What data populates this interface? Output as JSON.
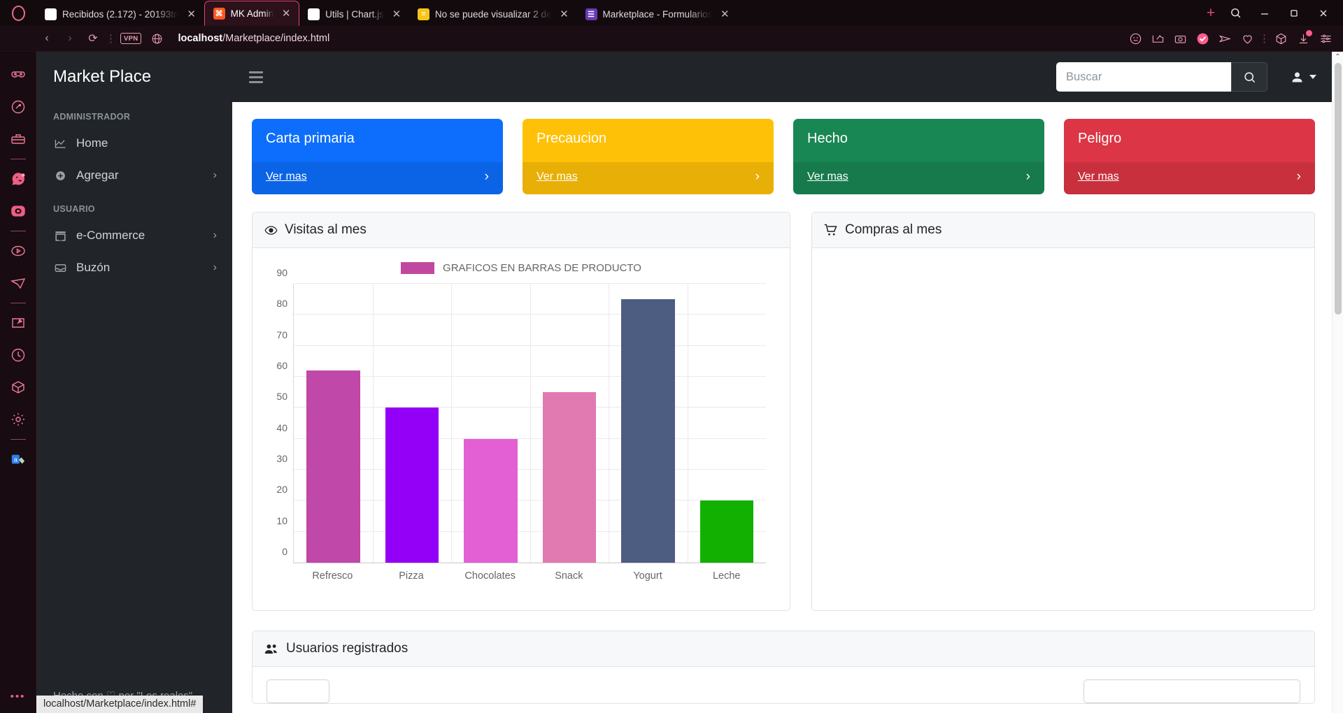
{
  "browser": {
    "tabs": [
      {
        "title": "Recibidos (2.172) - 20193tn",
        "favicon": "gmail-icon",
        "active": false
      },
      {
        "title": "MK Admin",
        "favicon": "mk-admin-icon",
        "active": true
      },
      {
        "title": "Utils | Chart.js",
        "favicon": "chartjs-icon",
        "active": false
      },
      {
        "title": "No se puede visualizar 2 de",
        "favicon": "sheets-icon",
        "active": false
      },
      {
        "title": "Marketplace - Formularios",
        "favicon": "forms-icon",
        "active": false
      }
    ],
    "new_tab_label": "+",
    "window_controls": {
      "search": "⌕",
      "minimize": "—",
      "maximize": "❐",
      "close": "✕"
    },
    "address": {
      "back": "‹",
      "forward": "›",
      "reload": "⟳",
      "vpn_badge": "VPN",
      "url_bold": "localhost",
      "url_rest": "/Marketplace/index.html"
    },
    "toolbar_icons": [
      "emoji-icon",
      "snapshot-icon",
      "camera-icon",
      "shield-check-icon",
      "send-icon",
      "heart-icon",
      "cube-icon",
      "download-icon",
      "settings-sliders-icon"
    ],
    "rail_icons": [
      "vpn-mask-icon",
      "search-tabs-icon",
      "workspace-icon",
      "whatsapp-icon",
      "instagram-icon",
      "player-icon",
      "telegram-icon",
      "pinboard-icon",
      "history-icon",
      "cube-icon",
      "settings-gear-icon",
      "extension-icon"
    ],
    "rail_more": "•••",
    "status_tooltip": "localhost/Marketplace/index.html#"
  },
  "app": {
    "brand": "Market Place",
    "sidebar": {
      "sections": [
        {
          "label": "ADMINISTRADOR",
          "items": [
            {
              "label": "Home",
              "icon": "chart-line-icon",
              "chevron": false
            },
            {
              "label": "Agregar",
              "icon": "plus-circle-icon",
              "chevron": true
            }
          ]
        },
        {
          "label": "USUARIO",
          "items": [
            {
              "label": "e-Commerce",
              "icon": "store-icon",
              "chevron": true
            },
            {
              "label": "Buzón",
              "icon": "inbox-icon",
              "chevron": true
            }
          ]
        }
      ],
      "footer": "Hecho con ♡ por \"Los reales\""
    },
    "topbar": {
      "menu_toggle": "hamburger-icon",
      "search_placeholder": "Buscar",
      "search_value": "",
      "search_button_icon": "search-icon",
      "user_icon": "user-icon"
    },
    "alert_cards": [
      {
        "title": "Carta primaria",
        "link": "Ver mas",
        "color": "#0d6efd",
        "arrow": "›"
      },
      {
        "title": "Precaucion",
        "link": "Ver mas",
        "color": "#ffc107",
        "arrow": "›"
      },
      {
        "title": "Hecho",
        "link": "Ver mas",
        "color": "#198754",
        "arrow": "›"
      },
      {
        "title": "Peligro",
        "link": "Ver mas",
        "color": "#dc3545",
        "arrow": "›"
      }
    ],
    "panels": {
      "visitas": {
        "title": "Visitas al mes",
        "icon": "eye-icon"
      },
      "compras": {
        "title": "Compras al mes",
        "icon": "cart-icon"
      },
      "usuarios": {
        "title": "Usuarios registrados",
        "icon": "users-icon"
      }
    },
    "scrollbar": {
      "up": "⌃",
      "down": "⌄"
    }
  },
  "chart_data": {
    "type": "bar",
    "title": "GRAFICOS EN BARRAS DE PRODUCTO",
    "legend": {
      "label": "GRAFICOS EN BARRAS DE PRODUCTO",
      "color": "#c0499f",
      "position": "top"
    },
    "categories": [
      "Refresco",
      "Pizza",
      "Chocolates",
      "Snack",
      "Yogurt",
      "Leche"
    ],
    "values": [
      62,
      50,
      40,
      55,
      85,
      20
    ],
    "colors": [
      "#bf48a8",
      "#9400f7",
      "#e35fd4",
      "#e07ab0",
      "#4d5d82",
      "#12b000"
    ],
    "xlabel": "",
    "ylabel": "",
    "ylim": [
      0,
      90
    ],
    "yticks": [
      0,
      10,
      20,
      30,
      40,
      50,
      60,
      70,
      80,
      90
    ],
    "grid": true
  }
}
